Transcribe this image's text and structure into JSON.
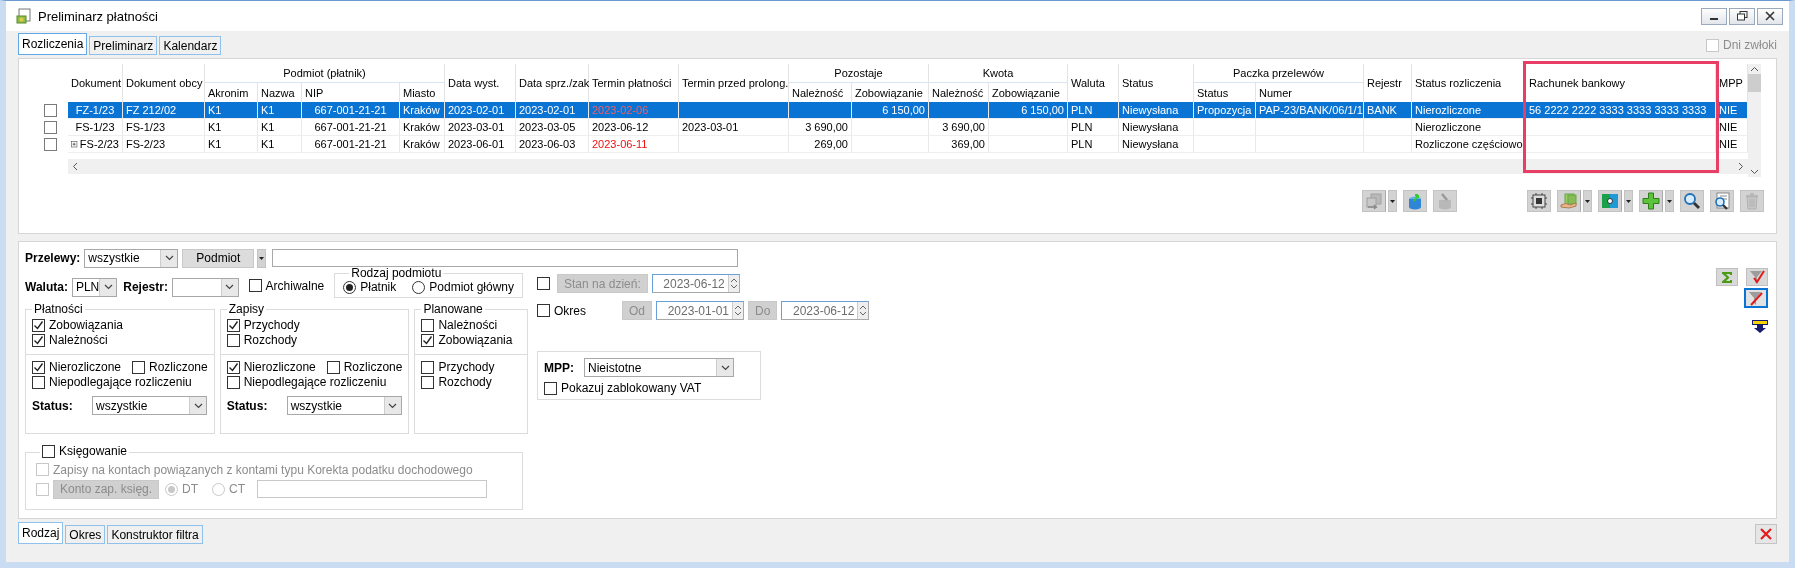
{
  "window": {
    "title": "Preliminarz płatności"
  },
  "tabs": [
    {
      "label": "Rozliczenia",
      "selected": true
    },
    {
      "label": "Preliminarz",
      "selected": false
    },
    {
      "label": "Kalendarz",
      "selected": false
    }
  ],
  "late_days": {
    "label": "Dni zwłoki",
    "checked": false,
    "disabled": true
  },
  "table": {
    "columns": [
      {
        "label": "Dokument"
      },
      {
        "label": "Dokument obcy"
      },
      {
        "label": "Podmiot (płatnik)",
        "children": [
          {
            "label": "Akronim"
          },
          {
            "label": "Nazwa"
          },
          {
            "label": "NIP"
          },
          {
            "label": "Miasto"
          }
        ]
      },
      {
        "label": "Data wyst."
      },
      {
        "label": "Data sprz./zak"
      },
      {
        "label": "Termin płatności"
      },
      {
        "label": "Termin przed prolong."
      },
      {
        "label": "Pozostaje",
        "children": [
          {
            "label": "Należność"
          },
          {
            "label": "Zobowiązanie"
          }
        ]
      },
      {
        "label": "Kwota",
        "children": [
          {
            "label": "Należność"
          },
          {
            "label": "Zobowiązanie"
          }
        ]
      },
      {
        "label": "Waluta"
      },
      {
        "label": "Status"
      },
      {
        "label": "Paczka przelewów",
        "children": [
          {
            "label": "Status"
          },
          {
            "label": "Numer"
          }
        ]
      },
      {
        "label": "Rejestr"
      },
      {
        "label": "Status rozliczenia"
      },
      {
        "label": "Rachunek bankowy",
        "highlighted": true
      },
      {
        "label": "MPP"
      }
    ],
    "rows": [
      {
        "selected": true,
        "checked": false,
        "expandable": false,
        "overdue": true,
        "cells": [
          "FZ-1/23",
          "FZ 212/02",
          [
            "K1",
            "K1",
            "667-001-21-21",
            "Kraków"
          ],
          "2023-02-01",
          "2023-02-01",
          "2023-02-06",
          null,
          [
            null,
            "6 150,00"
          ],
          [
            null,
            "6 150,00"
          ],
          "PLN",
          "Niewysłana",
          [
            "Propozycja",
            "PAP-23/BANK/06/1/1"
          ],
          "BANK",
          "Nierozliczone",
          "56 2222 2222 3333 3333 3333 3333",
          "NIE"
        ]
      },
      {
        "selected": false,
        "checked": false,
        "expandable": false,
        "overdue": false,
        "cells": [
          "FS-1/23",
          "FS-1/23",
          [
            "K1",
            "K1",
            "667-001-21-21",
            "Kraków"
          ],
          "2023-03-01",
          "2023-03-05",
          "2023-06-12",
          "2023-03-01",
          [
            "3 690,00",
            null
          ],
          [
            "3 690,00",
            null
          ],
          "PLN",
          "Niewysłana",
          [
            null,
            null
          ],
          null,
          "Nierozliczone",
          null,
          "NIE"
        ]
      },
      {
        "selected": false,
        "checked": false,
        "expandable": true,
        "overdue": true,
        "cells": [
          "FS-2/23",
          "FS-2/23",
          [
            "K1",
            "K1",
            "667-001-21-21",
            "Kraków"
          ],
          "2023-06-01",
          "2023-06-03",
          "2023-06-11",
          null,
          [
            "269,00",
            null
          ],
          [
            "369,00",
            null
          ],
          "PLN",
          "Niewysłana",
          [
            null,
            null
          ],
          null,
          "Rozliczone częściowo",
          null,
          "NIE"
        ]
      }
    ]
  },
  "toolbar": [
    [
      {
        "disabled": true,
        "dropdown": true
      },
      {
        "disabled": false,
        "dropdown": false
      },
      {
        "disabled": true,
        "dropdown": false
      }
    ],
    [
      {
        "disabled": false,
        "dropdown": false
      },
      {
        "disabled": false,
        "dropdown": true
      },
      {
        "disabled": false,
        "dropdown": true
      },
      {
        "disabled": false,
        "dropdown": true
      },
      {
        "disabled": false,
        "dropdown": false
      },
      {
        "disabled": false,
        "dropdown": false
      },
      {
        "disabled": true,
        "dropdown": false
      }
    ]
  ],
  "filter": {
    "transfers": {
      "label": "Przelewy:",
      "value": "wszystkie",
      "button": "Podmiot"
    },
    "currency": {
      "label": "Waluta:",
      "value": "PLN"
    },
    "register": {
      "label": "Rejestr:"
    },
    "archived": {
      "label": "Archiwalne",
      "checked": false
    },
    "entity_type": {
      "title": "Rodzaj podmiotu",
      "options": [
        {
          "label": "Płatnik",
          "selected": true
        },
        {
          "label": "Podmiot główny",
          "selected": false
        }
      ]
    },
    "as_of": {
      "checked": false,
      "button": "Stan na dzień:",
      "date": "2023-06-12",
      "disabled": true
    },
    "period": {
      "checked": false,
      "label": "Okres",
      "from_button": "Od",
      "from": "2023-01-01",
      "to_button": "Do",
      "to": "2023-06-12",
      "disabled": true
    },
    "groups": [
      {
        "title": "Płatności",
        "top": [
          {
            "label": "Zobowiązania",
            "checked": true
          },
          {
            "label": "Należności",
            "checked": true
          }
        ],
        "bottom": [
          [
            {
              "label": "Nierozliczone",
              "checked": true
            },
            {
              "label": "Rozliczone",
              "checked": false
            }
          ],
          [
            {
              "label": "Niepodlegające rozliczeniu",
              "checked": false
            }
          ]
        ],
        "status": {
          "label": "Status:",
          "value": "wszystkie"
        }
      },
      {
        "title": "Zapisy",
        "top": [
          {
            "label": "Przychody",
            "checked": true
          },
          {
            "label": "Rozchody",
            "checked": false
          }
        ],
        "bottom": [
          [
            {
              "label": "Nierozliczone",
              "checked": true
            },
            {
              "label": "Rozliczone",
              "checked": false
            }
          ],
          [
            {
              "label": "Niepodlegające rozliczeniu",
              "checked": false
            }
          ]
        ],
        "status": {
          "label": "Status:",
          "value": "wszystkie"
        }
      },
      {
        "title": "Planowane",
        "top": [
          {
            "label": "Należności",
            "checked": false
          },
          {
            "label": "Zobowiązania",
            "checked": true
          }
        ],
        "bottom": [
          [
            {
              "label": "Przychody",
              "checked": false
            }
          ],
          [
            {
              "label": "Rozchody",
              "checked": false
            }
          ]
        ]
      }
    ],
    "mpp": {
      "label": "MPP:",
      "value": "Nieistotne",
      "blocked_vat": {
        "label": "Pokazuj zablokowany VAT",
        "checked": false
      }
    },
    "posting": {
      "label": "Księgowanie",
      "checked": false,
      "options": [
        {
          "label": "Zapisy na kontach powiązanych z kontami typu Korekta podatku dochodowego",
          "checked": false,
          "disabled": true
        }
      ],
      "account": {
        "checked": false,
        "disabled": true,
        "button": "Konto zap. księg.",
        "radios": [
          {
            "label": "DT",
            "selected": true
          },
          {
            "label": "CT",
            "selected": false
          }
        ]
      }
    },
    "side_buttons": [
      {
        "selected": false
      },
      {
        "selected": false
      },
      {
        "selected": true
      }
    ]
  },
  "bottom_tabs": [
    {
      "label": "Rodzaj",
      "selected": true
    },
    {
      "label": "Okres",
      "selected": false
    },
    {
      "label": "Konstruktor filtra",
      "selected": false
    }
  ]
}
